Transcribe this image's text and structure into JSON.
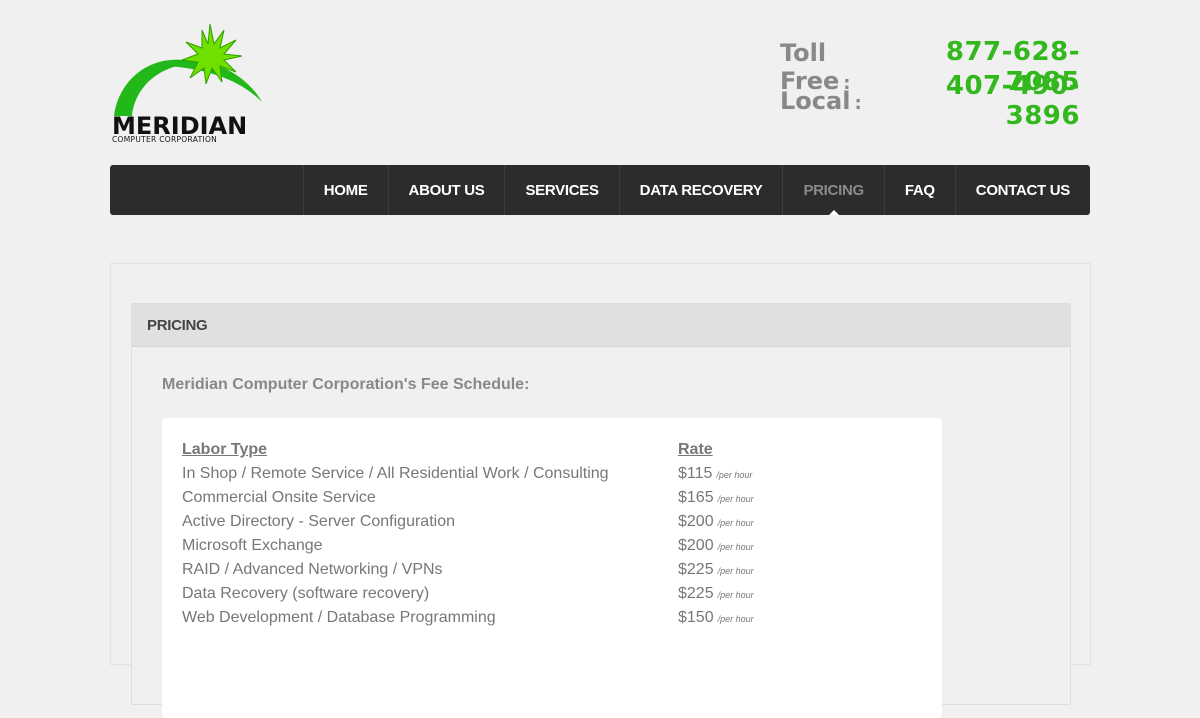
{
  "header": {
    "logo": {
      "wordmark": "MERIDIAN",
      "subline": "COMPUTER CORPORATION"
    },
    "phones": [
      {
        "label": "Toll Free",
        "number": "877-628-7085"
      },
      {
        "label": "Local",
        "number": "407-490-3896"
      }
    ],
    "colors": {
      "phone_number": "#32b81c",
      "logo_green": "#22b81a"
    }
  },
  "nav": {
    "items": [
      {
        "label": "HOME"
      },
      {
        "label": "ABOUT US"
      },
      {
        "label": "SERVICES"
      },
      {
        "label": "DATA RECOVERY"
      },
      {
        "label": "PRICING",
        "active": true
      },
      {
        "label": "FAQ"
      },
      {
        "label": "CONTACT  US"
      }
    ]
  },
  "panel": {
    "title": "PRICING",
    "intro": "Meridian Computer Corporation's Fee Schedule:",
    "table": {
      "headers": {
        "type": "Labor Type",
        "rate": "Rate"
      },
      "rows": [
        {
          "type": "In Shop / Remote Service / All Residential Work / Consulting",
          "rate": "$115",
          "unit": "/per hour"
        },
        {
          "type": "Commercial Onsite Service",
          "rate": "$165",
          "unit": "/per hour"
        },
        {
          "type": "Active Directory - Server Configuration",
          "rate": "$200",
          "unit": "/per hour"
        },
        {
          "type": "Microsoft Exchange",
          "rate": "$200",
          "unit": "/per hour"
        },
        {
          "type": "RAID / Advanced Networking / VPNs",
          "rate": "$225",
          "unit": "/per hour"
        },
        {
          "type": "Data Recovery (software recovery)",
          "rate": "$225",
          "unit": "/per hour"
        },
        {
          "type": "Web Development / Database Programming",
          "rate": "$150",
          "unit": "/per hour"
        }
      ]
    }
  }
}
